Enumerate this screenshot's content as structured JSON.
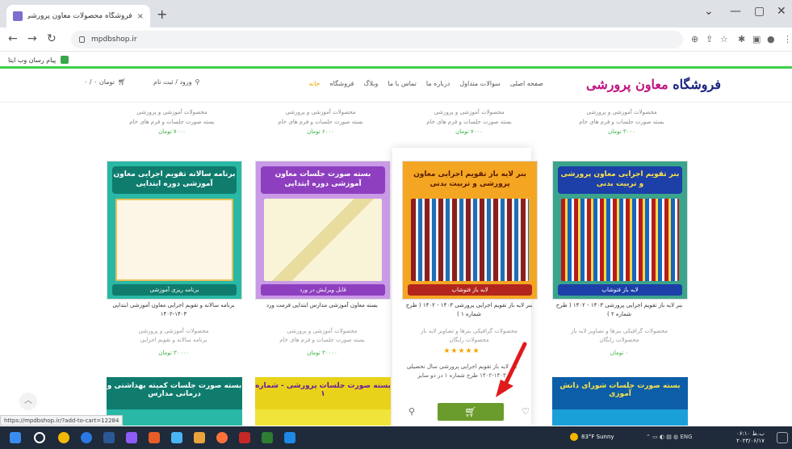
{
  "browser": {
    "tab_title": "فروشگاه محصولات معاون پرورشی",
    "tab_close": "×",
    "new_tab": "+",
    "url": "mpdbshop.ir",
    "bookmark_label": "پیام رسان وب ایتا",
    "win_controls": [
      "⌄",
      "—",
      "▢",
      "✕"
    ]
  },
  "header": {
    "logo_part1": "فروشگاه",
    "logo_part2": " معاون پرورشی",
    "menu": [
      "خانه",
      "فروشگاه",
      "وبلاگ",
      "تماس با ما",
      "درباره ما",
      "سوالات متداول",
      "صفحه اصلی"
    ],
    "account": "ورود / ثبت نام",
    "cart": "۰ / ۰ تومان"
  },
  "top_row": [
    {
      "line1": "محصولات آموزشی و پرورشی",
      "line2": "بسته صورت جلسات و فرم های خام",
      "price": "۳۰۰۰ تومان"
    },
    {
      "line1": "محصولات آموزشی و پرورشی",
      "line2": "بسته صورت جلسات و فرم های خام",
      "price": "۷۰۰۰ تومان"
    },
    {
      "line1": "محصولات آموزشی و پرورشی",
      "line2": "بسته صورت جلسات و فرم های خام",
      "price": "۶۰۰۰ تومان"
    },
    {
      "line1": "محصولات آموزشی و پرورشی",
      "line2": "بسته صورت جلسات و فرم های خام",
      "price": "۷۰۰۰ تومان"
    }
  ],
  "products": [
    {
      "thumb_head": "برنامه سالانه تقویم اجرایی معاون آموزشی دوره ابتدایی",
      "thumb_foot": "برنامه ریزی آموزشی",
      "title": "برنامه سالانه و تقویم اجرایی معاون آموزشی ابتدایی ۱۴۰۳-۱۴۰۲",
      "meta1": "محصولات آموزشی و پرورشی",
      "meta2": "برنامه سالانه و تقویم اجرایی",
      "price": "۳۰۰۰۰ تومان"
    },
    {
      "thumb_head": "بسته صورت جلسات معاون آموزشی دوره ابتدایی",
      "thumb_foot": "قابل ویرایش در ورد",
      "title": "بسته معاون آموزشی مدارس ابتدایی فرمت ورد",
      "meta1": "محصولات آموزشی و پرورشی",
      "meta2": "بسته صورت جلسات و فرم های خام",
      "price": "۳۰۰۰۰ تومان"
    },
    {
      "thumb_head": "بنر لایه باز تقویم اجرایی معاون پرورشی و تربیت بدنی",
      "thumb_foot": "لایه باز فتوشاپ",
      "title": "بنر لایه باز تقویم اجرایی پرورشی ۱۴۰۳ - ۱۴۰۲ ( طرح شماره ۱ )",
      "meta1": "محصولات گرافیکی بنرها و تصاویر لایه باز",
      "meta2": "محصولات رایگان",
      "stars": "★★★★★",
      "desc": "بنر لایه باز تقویم اجرایی پرورشی سال تحصیلی ۱۴۰۳-۱۴۰۲ طرح شماره ۱ در دو سایز"
    },
    {
      "thumb_head": "بنر تقویم اجرایی معاون پرورشی و تربیت بدنی",
      "thumb_foot": "لایه باز فتوشاپ",
      "title": "بنر لایه باز تقویم اجرایی پرورشی ۱۴۰۳ - ۱۴۰۲ ( طرح شماره ۲ )",
      "meta1": "محصولات گرافیکی بنرها و تصاویر لایه باز",
      "meta2": "محصولات رایگان",
      "price": "۰ تومان"
    }
  ],
  "bottom_row": [
    "بسته صورت جلسات کمیته بهداشتی و درمانی مدارس",
    "بسته صورت جلسات پرورشی - شماره ۱",
    "",
    "بسته صورت جلسات شورای دانش آموزی"
  ],
  "status_url": "https://mpdbshop.ir/?add-to-cart=12284",
  "taskbar": {
    "weather": "83°F Sunny",
    "lang": "ENG",
    "time": "۰۶:۱۰ ب.ظ",
    "date": "۲۰۲۳/۰۶/۱۷"
  },
  "colors": {
    "accent_green": "#6a9c2b",
    "header_green_line": "#3cd04a",
    "logo_magenta": "#c0137e",
    "menu_active": "#f3a400",
    "annotation_arrow": "#e0191b"
  }
}
